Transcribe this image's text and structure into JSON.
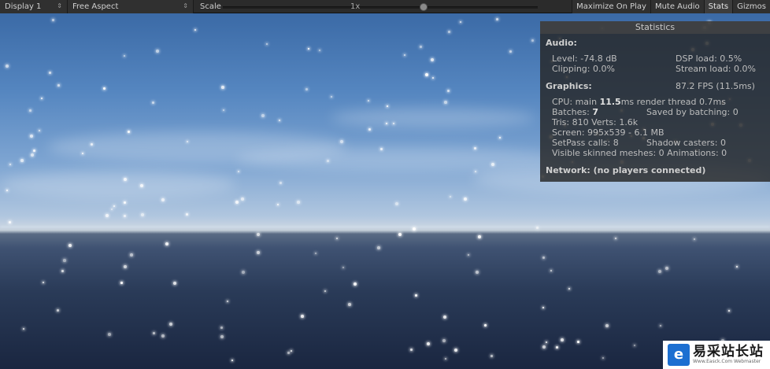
{
  "toolbar": {
    "display": "Display 1",
    "aspect": "Free Aspect",
    "scale_label": "Scale",
    "scale_value": "1x",
    "buttons": [
      "Maximize On Play",
      "Mute Audio",
      "Stats",
      "Gizmos"
    ]
  },
  "stats": {
    "title": "Statistics",
    "audio": {
      "header": "Audio:",
      "level": "Level: -74.8 dB",
      "dsp": "DSP load: 0.5%",
      "clipping": "Clipping: 0.0%",
      "stream": "Stream load: 0.0%"
    },
    "graphics": {
      "header": "Graphics:",
      "fps": "87.2 FPS (11.5ms)",
      "cpu_prefix": "CPU: main ",
      "cpu_main": "11.5",
      "cpu_suffix": "ms  render thread 0.7ms",
      "batches_prefix": "Batches: ",
      "batches_value": "7",
      "saved": "Saved by batching: 0",
      "tris": "Tris: 810  Verts: 1.6k",
      "screen": "Screen: 995x539 - 6.1 MB",
      "setpass": "SetPass calls: 8",
      "shadow": "Shadow casters: 0",
      "skinned": "Visible skinned meshes: 0  Animations: 0"
    },
    "network": "Network: (no players connected)"
  },
  "watermark": {
    "name": "易采站长站",
    "url": "Www.Easck.Com  Webmaster"
  }
}
